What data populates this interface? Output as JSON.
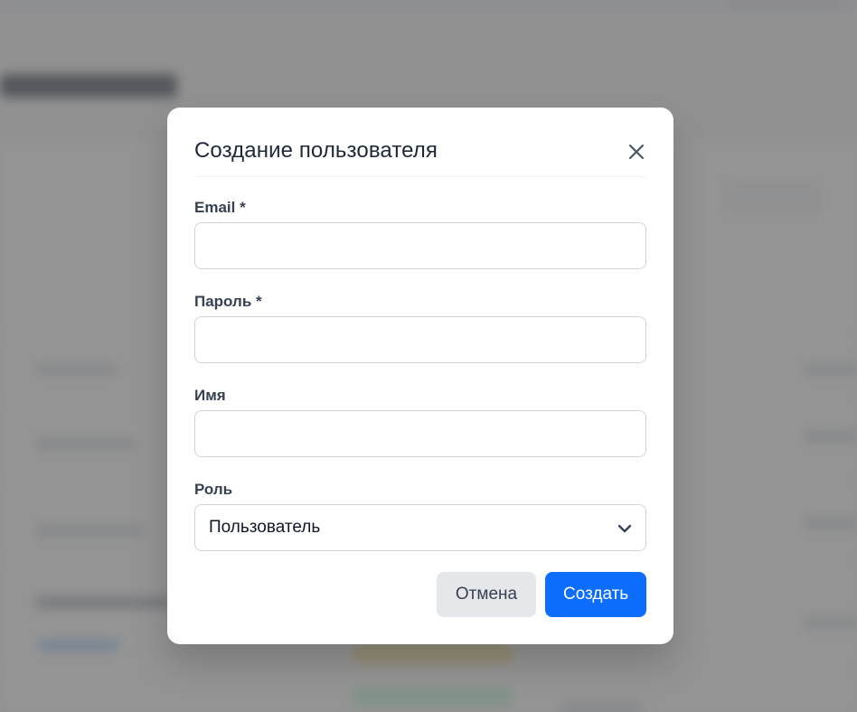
{
  "modal": {
    "title": "Создание пользователя",
    "close_icon": "close-icon",
    "fields": {
      "email": {
        "label": "Email *",
        "value": "",
        "placeholder": ""
      },
      "password": {
        "label": "Пароль *",
        "value": "",
        "placeholder": ""
      },
      "name": {
        "label": "Имя",
        "value": "",
        "placeholder": ""
      },
      "role": {
        "label": "Роль",
        "selected": "Пользователь",
        "icon": "chevron-down-icon"
      }
    },
    "actions": {
      "cancel_label": "Отмена",
      "create_label": "Создать"
    }
  },
  "colors": {
    "primary": "#0d6efd",
    "secondary_bg": "#e5e7eb",
    "overlay": "#6b6b6b"
  }
}
